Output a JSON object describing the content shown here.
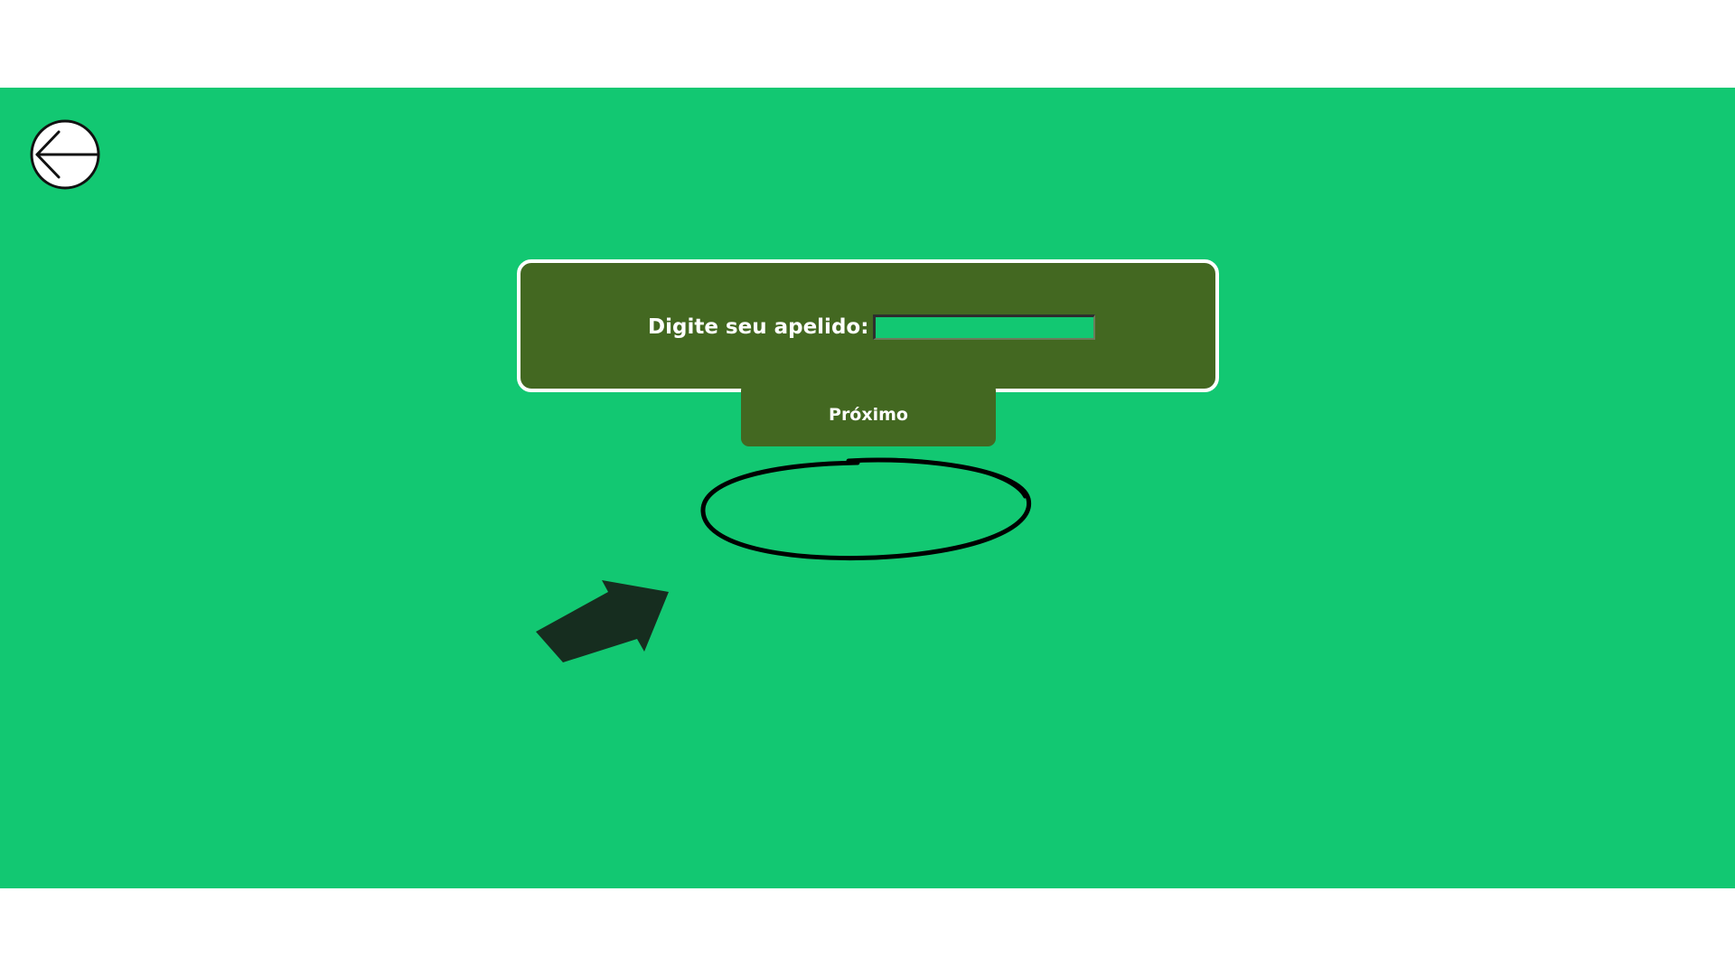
{
  "colors": {
    "background": "#12c872",
    "panel": "#436821",
    "panel_border": "#ffffff",
    "input_fill": "#12c872",
    "arrow": "#162d1f",
    "ellipse": "#000000",
    "text": "#ffffff"
  },
  "back": {
    "icon": "arrow-left-circle-icon"
  },
  "nickname": {
    "label": "Digite seu apelido:",
    "value": "",
    "placeholder": ""
  },
  "next": {
    "label": "Próximo"
  },
  "annotations": {
    "ellipse": "circle-highlight",
    "arrow": "pointer-arrow-icon"
  }
}
